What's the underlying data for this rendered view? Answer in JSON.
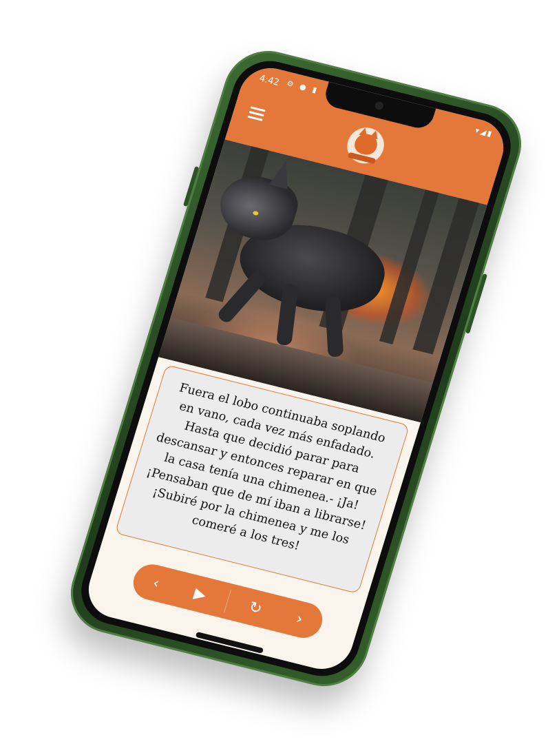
{
  "status_bar": {
    "time": "4:42",
    "left_icons": "⚙ ● ▮",
    "right_icons": "▾◢▮"
  },
  "app_bar": {
    "menu_icon": "hamburger-menu-icon",
    "logo": "fox-reading-book-logo"
  },
  "illustration": {
    "subject": "wolf-running-through-fire-forest-image"
  },
  "story": {
    "text": "Fuera el lobo continuaba soplando en vano, cada vez más enfadado. Hasta que decidió parar para descansar y entonces reparar en que la casa tenía una chimenea.- ¡Ja! ¡Pensaban que de mí iban a librarse! ¡Subiré por la chimenea y me los comeré a los tres!"
  },
  "controls": {
    "prev": "‹",
    "play": "▶",
    "replay": "↻",
    "next": "›"
  },
  "colors": {
    "accent": "#e3783a",
    "phone": "#2f5628",
    "card_bg": "#ececec",
    "screen_bg": "#faf5ec"
  }
}
